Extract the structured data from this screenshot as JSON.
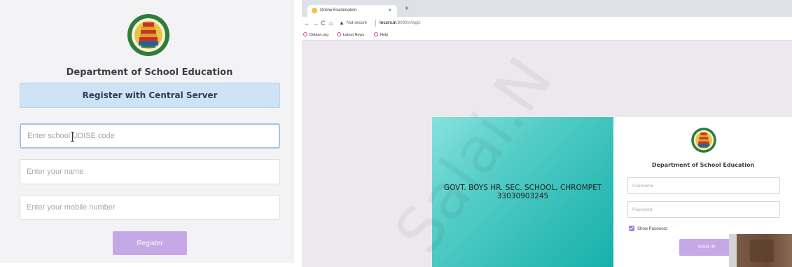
{
  "left_panel": {
    "department_title": "Department of School Education",
    "register_banner": "Register with Central Server",
    "fields": [
      {
        "placeholder": "Enter school UDISE code"
      },
      {
        "placeholder": "Enter your name"
      },
      {
        "placeholder": "Enter your mobile number"
      }
    ],
    "register_button": "Register"
  },
  "browser": {
    "tab_title": "Online Examination",
    "tab_close": "×",
    "new_tab": "+",
    "nav": {
      "back": "←",
      "forward": "→",
      "reload": "C",
      "home": "⌂"
    },
    "security_label": "Not secure",
    "url_host": "locsrv.in",
    "url_path": ":8080/#/login",
    "bookmarks": [
      "Debian.org",
      "Latest News",
      "Help"
    ]
  },
  "page": {
    "school_name": "GOVT. BOYS HR. SEC. SCHOOL, CHROMPET",
    "school_code": "33030903245",
    "department_title": "Department of School Education",
    "username_placeholder": "Username",
    "password_placeholder": "Password",
    "show_password_label": "Show Password",
    "signin_button": "SIGN IN"
  },
  "watermark": "Salai.N",
  "colors": {
    "accent_purple": "#c6a8e6",
    "banner_blue": "#cfe3f6",
    "teal": "#16b0aa"
  }
}
